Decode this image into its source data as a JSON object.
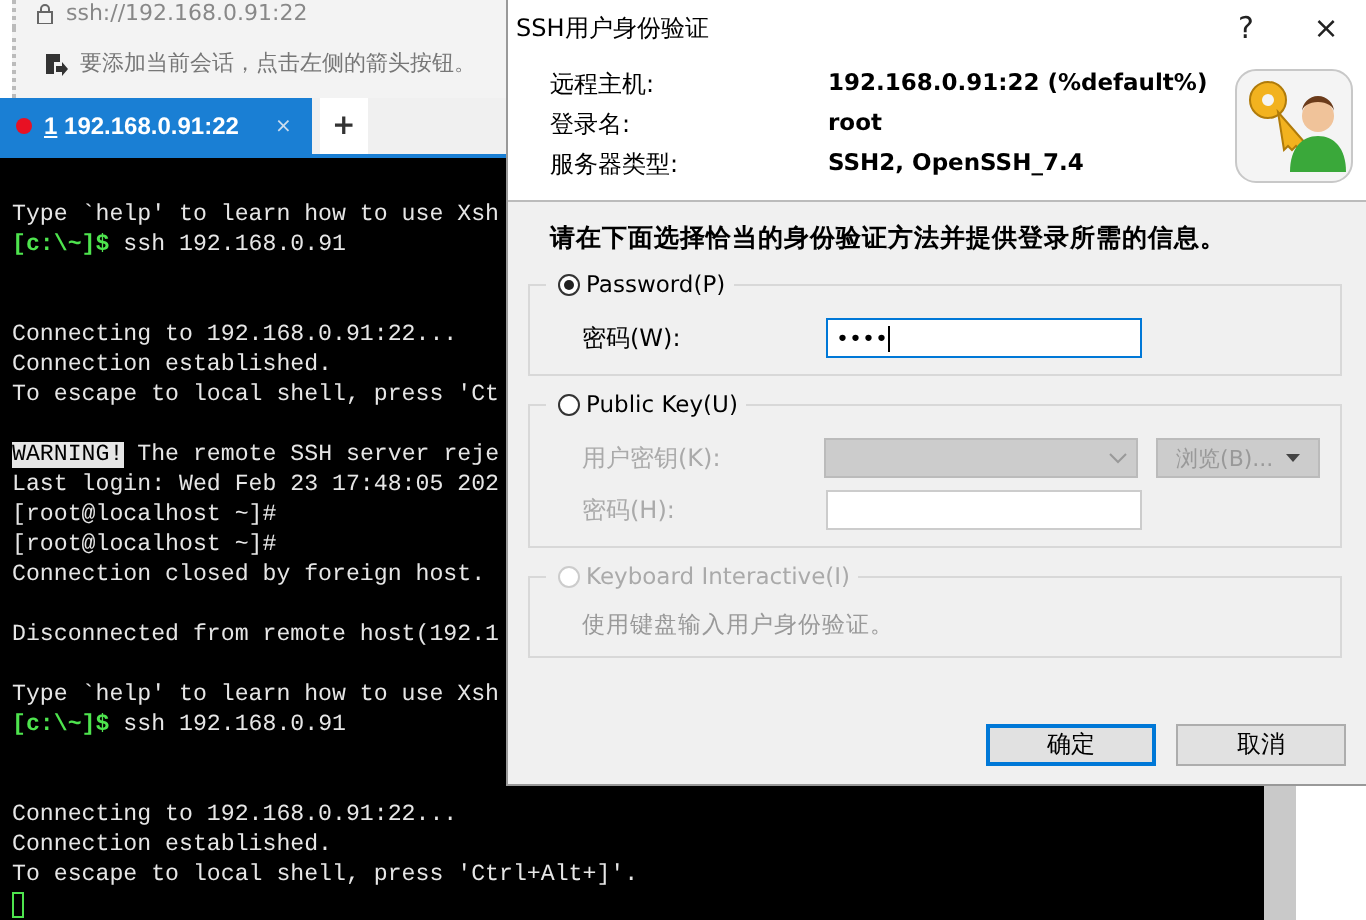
{
  "address_bar": {
    "url": "ssh://192.168.0.91:22"
  },
  "info_bar": {
    "text": "要添加当前会话，点击左侧的箭头按钮。"
  },
  "tabs": [
    {
      "number": "1",
      "label": "192.168.0.91:22",
      "close": "×",
      "selected": true,
      "connected": false
    }
  ],
  "new_tab": "+",
  "terminal": {
    "lines": [
      {
        "kind": "text",
        "text": "Type `help' to learn how to use Xsh"
      },
      {
        "kind": "prompt",
        "prefix": "[c:\\~]$",
        "text": " ssh 192.168.0.91"
      },
      {
        "kind": "blank"
      },
      {
        "kind": "blank"
      },
      {
        "kind": "text",
        "text": "Connecting to 192.168.0.91:22..."
      },
      {
        "kind": "text",
        "text": "Connection established."
      },
      {
        "kind": "text",
        "text": "To escape to local shell, press 'Ct"
      },
      {
        "kind": "blank"
      },
      {
        "kind": "warning",
        "prefix": "WARNING!",
        "text": " The remote SSH server reje"
      },
      {
        "kind": "text",
        "text": "Last login: Wed Feb 23 17:48:05 202"
      },
      {
        "kind": "text",
        "text": "[root@localhost ~]#"
      },
      {
        "kind": "text",
        "text": "[root@localhost ~]#"
      },
      {
        "kind": "text",
        "text": "Connection closed by foreign host."
      },
      {
        "kind": "blank"
      },
      {
        "kind": "text",
        "text": "Disconnected from remote host(192.1"
      },
      {
        "kind": "blank"
      },
      {
        "kind": "text",
        "text": "Type `help' to learn how to use Xsh"
      },
      {
        "kind": "prompt",
        "prefix": "[c:\\~]$",
        "text": " ssh 192.168.0.91"
      },
      {
        "kind": "blank"
      },
      {
        "kind": "blank"
      },
      {
        "kind": "text",
        "text": "Connecting to 192.168.0.91:22..."
      },
      {
        "kind": "text",
        "text": "Connection established."
      },
      {
        "kind": "text",
        "text": "To escape to local shell, press 'Ctrl+Alt+]'."
      },
      {
        "kind": "cursor"
      }
    ]
  },
  "dialog": {
    "title": "SSH用户身份验证",
    "help": "?",
    "close": "×",
    "info": [
      {
        "label": "远程主机:",
        "value": "192.168.0.91:22 (%default%)"
      },
      {
        "label": "登录名:",
        "value": "root"
      },
      {
        "label": "服务器类型:",
        "value": "SSH2, OpenSSH_7.4"
      }
    ],
    "instruction": "请在下面选择恰当的身份验证方法并提供登录所需的信息。",
    "auth_methods": [
      {
        "label": "Password(P)",
        "selected": true,
        "disabled": false,
        "fields": [
          {
            "kind": "input",
            "label": "密码(W):",
            "value": "••••",
            "disabled": false,
            "focused": true
          }
        ]
      },
      {
        "label": "Public Key(U)",
        "selected": false,
        "disabled": false,
        "fields": [
          {
            "kind": "dropdown",
            "label": "用户密钥(K):",
            "disabled": true,
            "button": "浏览(B)..."
          },
          {
            "kind": "input",
            "label": "密码(H):",
            "disabled": true,
            "focused": false
          }
        ]
      },
      {
        "label": "Keyboard Interactive(I)",
        "selected": false,
        "disabled": true,
        "note": "使用键盘输入用户身份验证。"
      }
    ],
    "buttons": [
      {
        "label": "确定",
        "focused": true
      },
      {
        "label": "取消",
        "focused": false
      }
    ]
  }
}
